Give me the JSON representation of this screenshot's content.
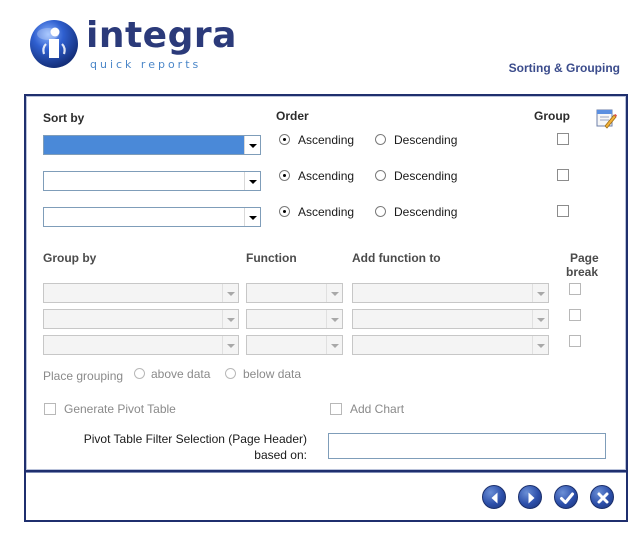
{
  "brand": {
    "name": "integra",
    "tagline": "quick reports"
  },
  "page_heading": "Sorting & Grouping",
  "sort": {
    "sort_by_label": "Sort by",
    "order_label": "Order",
    "group_label": "Group",
    "rows": [
      {
        "value": "",
        "order": "Ascending",
        "ascending_label": "Ascending",
        "descending_label": "Descending",
        "group_checked": false,
        "highlighted": true
      },
      {
        "value": "",
        "order": "Ascending",
        "ascending_label": "Ascending",
        "descending_label": "Descending",
        "group_checked": false,
        "highlighted": false
      },
      {
        "value": "",
        "order": "Ascending",
        "ascending_label": "Ascending",
        "descending_label": "Descending",
        "group_checked": false,
        "highlighted": false
      }
    ]
  },
  "grouping": {
    "group_by_label": "Group by",
    "function_label": "Function",
    "add_function_to_label": "Add function to",
    "page_break_label_line1": "Page",
    "page_break_label_line2": "break",
    "rows": [
      {
        "group_by": "",
        "function": "",
        "add_to": "",
        "page_break": false
      },
      {
        "group_by": "",
        "function": "",
        "add_to": "",
        "page_break": false
      },
      {
        "group_by": "",
        "function": "",
        "add_to": "",
        "page_break": false
      }
    ]
  },
  "place_grouping": {
    "label": "Place grouping",
    "above_label": "above data",
    "below_label": "below data"
  },
  "options": {
    "generate_pivot_label": "Generate Pivot Table",
    "add_chart_label": "Add Chart",
    "pivot_filter_label_line1": "Pivot Table Filter Selection (Page Header)",
    "pivot_filter_label_line2": "based on:",
    "pivot_filter_value": ""
  },
  "footer_buttons": [
    {
      "icon": "arrow-left-icon",
      "action": "back"
    },
    {
      "icon": "arrow-right-icon",
      "action": "next"
    },
    {
      "icon": "checkmark-icon",
      "action": "finish"
    },
    {
      "icon": "close-icon",
      "action": "cancel"
    }
  ],
  "colors": {
    "frame": "#1f2f6e",
    "accent": "#2c4faa",
    "highlight": "#4a89d8",
    "heading": "#3b4c8c"
  }
}
